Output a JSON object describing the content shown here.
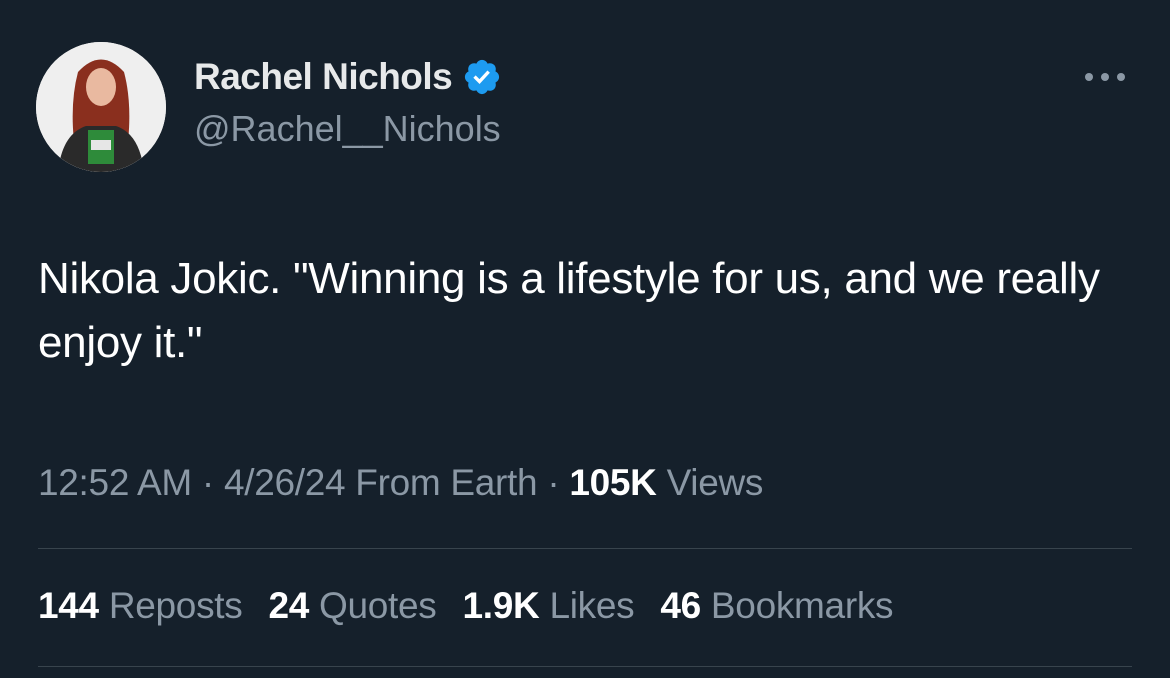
{
  "author": {
    "name": "Rachel Nichols",
    "handle": "@Rachel__Nichols",
    "verified": true
  },
  "tweet": {
    "text": "Nikola Jokic. \"Winning is a lifestyle for us, and we really enjoy it.\""
  },
  "meta": {
    "time": "12:52 AM",
    "separator1": "·",
    "date": "4/26/24",
    "source": "From Earth",
    "separator2": "·",
    "views_count": "105K",
    "views_label": "Views"
  },
  "stats": {
    "reposts": {
      "count": "144",
      "label": "Reposts"
    },
    "quotes": {
      "count": "24",
      "label": "Quotes"
    },
    "likes": {
      "count": "1.9K",
      "label": "Likes"
    },
    "bookmarks": {
      "count": "46",
      "label": "Bookmarks"
    }
  },
  "icons": {
    "verified": "verified-badge-icon",
    "more": "more-dots-icon"
  },
  "colors": {
    "background": "#15202b",
    "text_primary": "#e7e9ea",
    "text_secondary": "#8b98a5",
    "verified_blue": "#1d9bf0",
    "divider": "#38444d"
  }
}
